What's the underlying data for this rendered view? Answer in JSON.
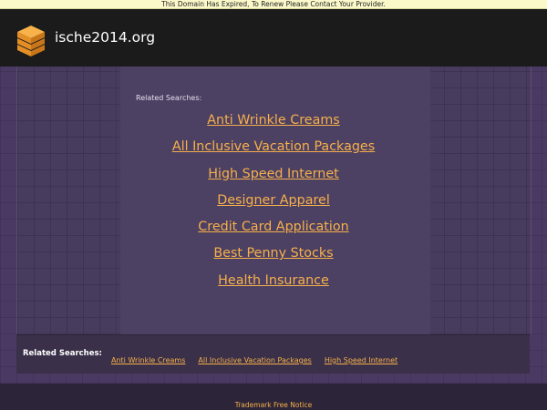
{
  "notice": {
    "text": "This Domain Has Expired, To Renew Please Contact Your Provider."
  },
  "header": {
    "domain": "ische2014.org",
    "logo_icon": "stacked-cubes-icon",
    "logo_color": "#f4a43b"
  },
  "main": {
    "related_label": "Related Searches:",
    "links": [
      "Anti Wrinkle Creams",
      "All Inclusive Vacation Packages",
      "High Speed Internet",
      "Designer Apparel",
      "Credit Card Application",
      "Best Penny Stocks",
      "Health Insurance"
    ]
  },
  "bottom_bar": {
    "label": "Related Searches:",
    "links": [
      "Anti Wrinkle Creams",
      "All Inclusive Vacation Packages",
      "High Speed Internet"
    ]
  },
  "footer": {
    "link": "Trademark Free Notice"
  },
  "colors": {
    "link": "#f6b04a",
    "background": "#4a3a63",
    "header_bg": "#1b1b1c"
  }
}
